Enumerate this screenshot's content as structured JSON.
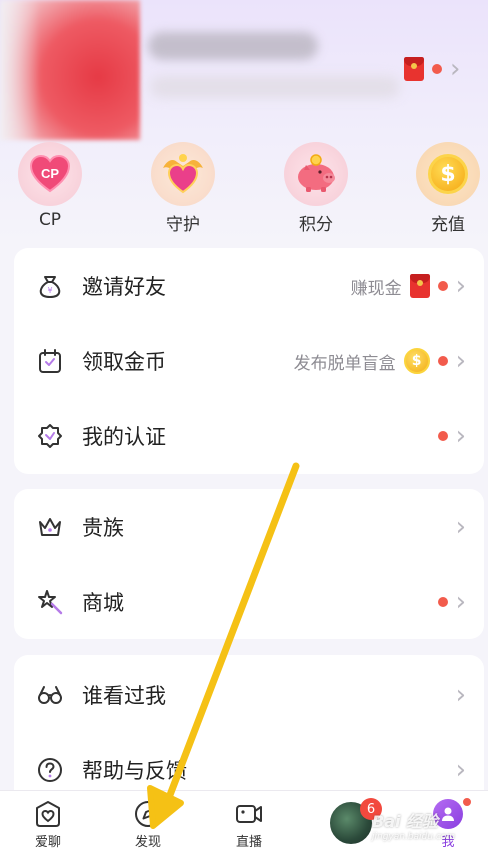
{
  "quick_actions": [
    {
      "label": "CP",
      "icon": "cp-heart-icon"
    },
    {
      "label": "守护",
      "icon": "guard-heart-icon"
    },
    {
      "label": "积分",
      "icon": "piggy-bank-icon"
    },
    {
      "label": "充值",
      "icon": "coin-icon"
    }
  ],
  "card1": [
    {
      "label": "邀请好友",
      "hint": "赚现金",
      "icon": "money-bag-icon"
    },
    {
      "label": "领取金币",
      "hint": "发布脱单盲盒",
      "icon": "calendar-check-icon"
    },
    {
      "label": "我的认证",
      "hint": "",
      "icon": "badge-check-icon"
    }
  ],
  "card2": [
    {
      "label": "贵族",
      "icon": "crown-icon"
    },
    {
      "label": "商城",
      "icon": "magic-wand-star-icon"
    }
  ],
  "card3": [
    {
      "label": "谁看过我",
      "icon": "glasses-icon"
    },
    {
      "label": "帮助与反馈",
      "icon": "help-circle-icon"
    }
  ],
  "coin_symbol": "$",
  "nav": {
    "items": [
      {
        "label": "爱聊",
        "icon": "heart-home-icon"
      },
      {
        "label": "发现",
        "icon": "compass-icon"
      },
      {
        "label": "直播",
        "icon": "video-camera-icon"
      },
      {
        "label": "我",
        "icon": "me-icon"
      }
    ],
    "badge_count": "6"
  },
  "watermark": {
    "main": "Bai 经验",
    "sub": "jingyan.baidu.com"
  },
  "colors": {
    "accent": "#8a3fe0",
    "dot": "#f25b4c",
    "arrow": "#f5c115"
  }
}
